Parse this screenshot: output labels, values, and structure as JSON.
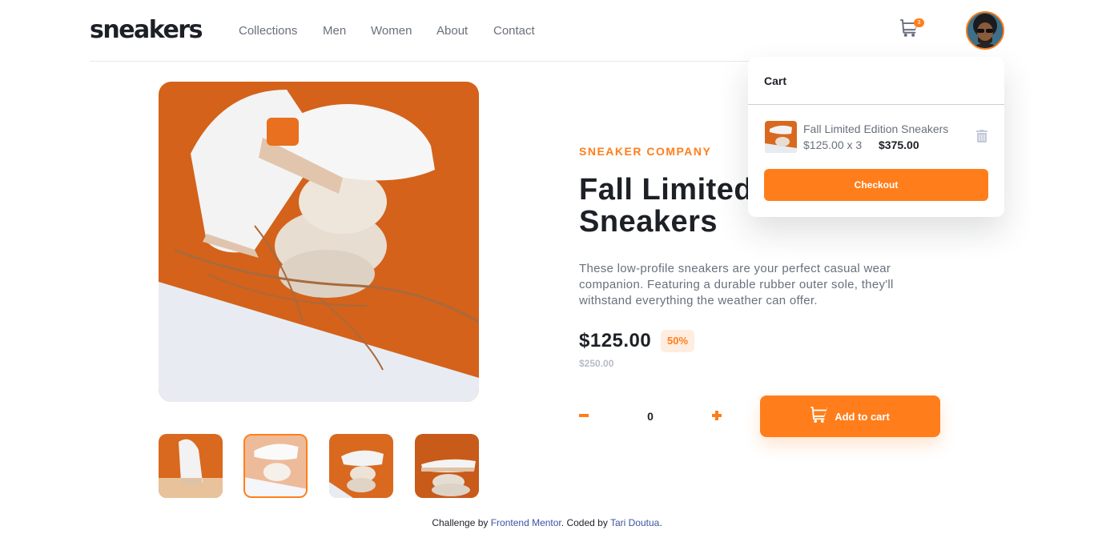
{
  "header": {
    "logo": "sneakers",
    "nav": [
      "Collections",
      "Men",
      "Women",
      "About",
      "Contact"
    ],
    "cart_count": "3"
  },
  "colors": {
    "accent": "#ff7e1b",
    "pale_accent": "#ffede0",
    "dark": "#1d2026",
    "grey": "#69707d",
    "light_grey": "#b6bcc8"
  },
  "product": {
    "company": "SNEAKER COMPANY",
    "title_line1": "Fall Limited",
    "title_line2": "Sneakers",
    "description": "These low-profile sneakers are your perfect casual wear companion. Featuring a durable rubber outer sole, they'll withstand everything the weather can offer.",
    "price": "$125.00",
    "discount": "50%",
    "old_price": "$250.00",
    "quantity": "0",
    "add_to_cart": "Add to cart"
  },
  "gallery": {
    "active_thumb": 2,
    "thumb_count": 4
  },
  "cart": {
    "title": "Cart",
    "item_name": "Fall Limited Edition Sneakers",
    "item_calc": "$125.00 x 3",
    "item_total": "$375.00",
    "checkout": "Checkout"
  },
  "footer": {
    "prefix": "Challenge by ",
    "link1": "Frontend Mentor",
    "middle": ". Coded by ",
    "link2": "Tari Doutua",
    "suffix": "."
  },
  "icons": {
    "cart": "cart-icon",
    "minus": "minus-icon",
    "plus": "plus-icon",
    "trash": "trash-icon"
  }
}
